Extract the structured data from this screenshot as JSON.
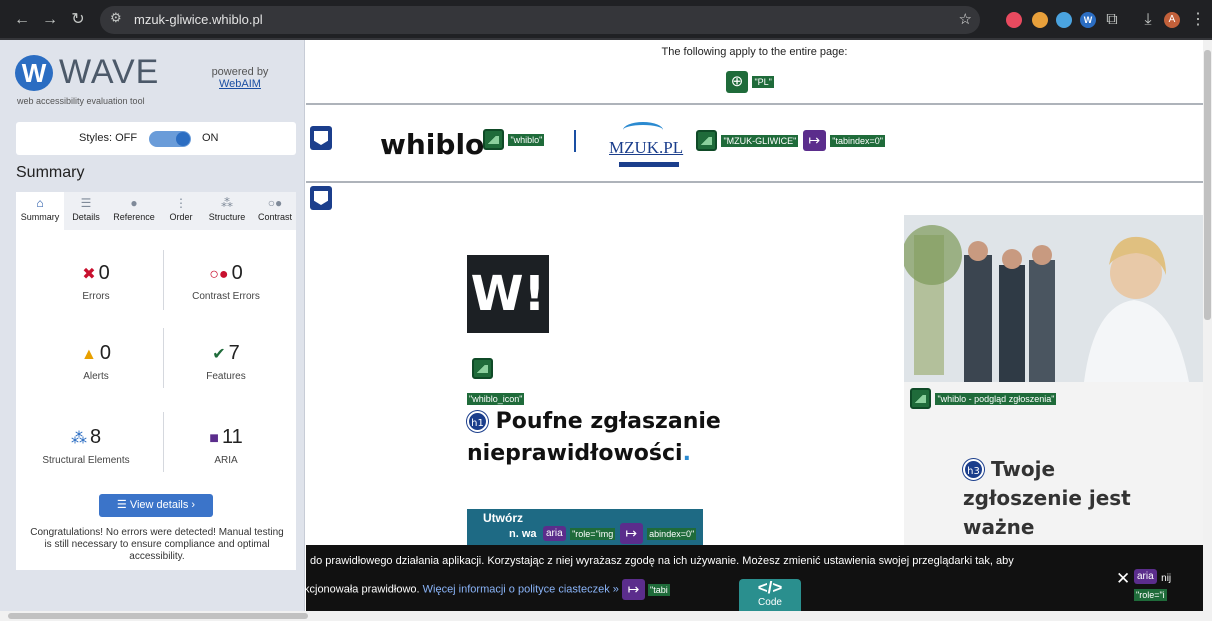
{
  "browser": {
    "url": "mzuk-gliwice.whiblo.pl",
    "avatar": "A"
  },
  "wave": {
    "logo_text": "WAVE",
    "tagline": "web accessibility evaluation tool",
    "powered_by": "powered by",
    "webaim": "WebAIM",
    "styles_label": "Styles:",
    "styles_off": "OFF",
    "styles_on": "ON",
    "summary_title": "Summary",
    "tabs": [
      {
        "label": "Summary",
        "icon": "home-icon"
      },
      {
        "label": "Details",
        "icon": "list-icon"
      },
      {
        "label": "Reference",
        "icon": "info-icon"
      },
      {
        "label": "Order",
        "icon": "order-icon"
      },
      {
        "label": "Structure",
        "icon": "structure-icon"
      },
      {
        "label": "Contrast",
        "icon": "contrast-icon"
      }
    ],
    "stats": {
      "errors": {
        "count": "0",
        "label": "Errors"
      },
      "contrast": {
        "count": "0",
        "label": "Contrast Errors"
      },
      "alerts": {
        "count": "0",
        "label": "Alerts"
      },
      "features": {
        "count": "7",
        "label": "Features"
      },
      "structural": {
        "count": "8",
        "label": "Structural Elements"
      },
      "aria": {
        "count": "11",
        "label": "ARIA"
      }
    },
    "view_details": "View details ›",
    "congrats": "Congratulations! No errors were detected! Manual testing is still necessary to ensure compliance and optimal accessibility."
  },
  "page": {
    "apply_text": "The following apply to the entire page:",
    "lang_label": "\"PL\"",
    "brand": "whiblo",
    "brand_alt": "\"whiblo\"",
    "mzuk_text": "MZUK.PL",
    "mzuk_alt": "\"MZUK-GLIWICE\"",
    "tabindex": "\"tabindex=0\"",
    "icon_alt": "\"whiblo_icon\"",
    "h1_badge": "h1",
    "h1_text": "Poufne zgłaszanie nieprawidłowości",
    "h1_dot": ".",
    "cta_text": "Utwórz",
    "cta_frag": "n. wa",
    "aria": "aria",
    "role_img": "\"role=\"img",
    "tabindex_frag": "abindex=0\"",
    "photo_alt": "\"whiblo - podgląd zgłoszenia\"",
    "h3_badge": "h3",
    "h3_text": "Twoje zgłoszenie jest ważne",
    "cookie_line1": "do prawidłowego działania aplikacji. Korzystając z niej wyrażasz zgodę na ich używanie. Możesz zmienić ustawienia swojej przeglądarki tak, aby",
    "cookie_line2": "kcjonowała prawidłowo.",
    "cookie_link": "Więcej informacji o polityce ciasteczek »",
    "cookie_tab": "\"tabi",
    "code_label": "Code",
    "close_label": "✕",
    "right_frag": "nij",
    "right_role": "\"role=\"i"
  },
  "colors": {
    "wave_blue": "#2b6dc2",
    "feature_green": "#1f6b3a",
    "aria_purple": "#5b2d8c",
    "structure_navy": "#1b3e8c"
  }
}
